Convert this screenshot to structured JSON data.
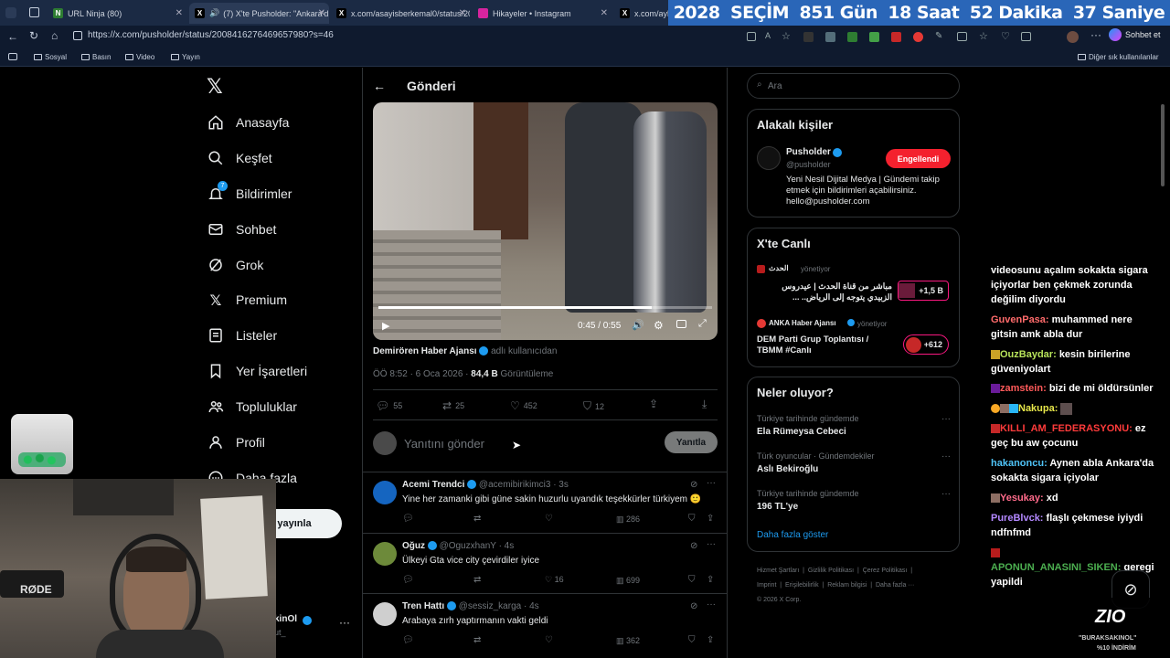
{
  "browser": {
    "tabs": [
      {
        "label": "URL Ninja (80)",
        "active": false
      },
      {
        "label": "(7) X'te Pusholder: \"Ankara'd",
        "active": true
      },
      {
        "label": "x.com/asayisberkemal0/status/20",
        "active": false
      },
      {
        "label": "Hikayeler • Instagram",
        "active": false
      },
      {
        "label": "x.com/ayk",
        "active": false
      }
    ],
    "url": "https://x.com/pusholder/status/2008416276469657980?s=46",
    "chat_button": "Sohbet et",
    "bookmarks": [
      "Sosyal",
      "Basın",
      "Video",
      "Yayın"
    ],
    "other_bookmarks": "Diğer sık kullanılanlar"
  },
  "banner": {
    "items": [
      "2028",
      "SEÇİM",
      "851 Gün",
      "18 Saat",
      "52 Dakika",
      "37 Saniye"
    ]
  },
  "sidebar": {
    "items": [
      {
        "label": "Anasayfa",
        "icon": "home-icon"
      },
      {
        "label": "Keşfet",
        "icon": "search-icon"
      },
      {
        "label": "Bildirimler",
        "icon": "bell-icon"
      },
      {
        "label": "Sohbet",
        "icon": "mail-icon"
      },
      {
        "label": "Grok",
        "icon": "grok-icon"
      },
      {
        "label": "Premium",
        "icon": "x-logo-icon"
      },
      {
        "label": "Listeler",
        "icon": "list-icon"
      },
      {
        "label": "Yer İşaretleri",
        "icon": "bookmark-icon"
      },
      {
        "label": "Topluluklar",
        "icon": "people-icon"
      },
      {
        "label": "Profil",
        "icon": "user-icon"
      },
      {
        "label": "Daha fazla",
        "icon": "more-icon"
      }
    ],
    "notification_badge": "7",
    "post_button": "yayınla",
    "account_name": "kinOl",
    "account_handle": "ut_"
  },
  "main": {
    "header_title": "Gönderi",
    "video_time": "0:45 / 0:55",
    "video_progress": 0.82,
    "attribution_name": "Demirören Haber Ajansı",
    "attribution_suffix": "adlı kullanıcıdan",
    "post_time": "ÖÖ 8:52 · 6 Oca 2026 ·",
    "views": "84,4 B",
    "views_label": "Görüntüleme",
    "stats": {
      "replies": "55",
      "reposts": "25",
      "likes": "452",
      "bookmarks": "12"
    },
    "reply_placeholder": "Yanıtını gönder",
    "reply_button": "Yanıtla",
    "replies": [
      {
        "name": "Acemi Trendci",
        "handle": "@acemibirikimci3 · 3s",
        "text": "Yine her zamanki gibi güne sakin huzurlu uyandık teşekkürler türkiyem 🙂",
        "views": "286",
        "likes": ""
      },
      {
        "name": "Oğuz",
        "handle": "@OguzxhanY · 4s",
        "text": "Ülkeyi Gta vice city çevirdiler iyice",
        "views": "699",
        "likes": "16"
      },
      {
        "name": "Tren Hattı",
        "handle": "@sessiz_karga · 4s",
        "text": "Arabaya zırh yaptırmanın vakti geldi",
        "views": "362",
        "likes": ""
      }
    ]
  },
  "right": {
    "search_placeholder": "Ara",
    "related_title": "Alakalı kişiler",
    "related_name": "Pusholder",
    "related_handle": "@pusholder",
    "related_button": "Engellendi",
    "related_bio": "Yeni Nesil Dijital Medya | Gündemi takip etmek için bildirimleri açabilirsiniz. hello@pusholder.com",
    "live_title": "X'te Canlı",
    "live": [
      {
        "host": "الحدث",
        "role": "yönetiyor",
        "title": "مباشر من قناة الحدث | عيدروس الزبيدي يتوجه إلى الرياض.. ...",
        "count": "+1,5 B"
      },
      {
        "host": "ANKA Haber Ajansı",
        "role": "yönetiyor",
        "title": "DEM Parti Grup Toplantısı / TBMM #Canlı",
        "count": "+612"
      }
    ],
    "trends_title": "Neler oluyor?",
    "trends": [
      {
        "label": "Türkiye tarihinde gündemde",
        "title": "Ela Rümeysa Cebeci"
      },
      {
        "label": "Türk oyuncular · Gündemdekiler",
        "title": "Aslı Bekiroğlu"
      },
      {
        "label": "Türkiye tarihinde gündemde",
        "title": "196 TL'ye"
      }
    ],
    "show_more": "Daha fazla göster",
    "footer_links": [
      "Hizmet Şartları",
      "Gizlilik Politikası",
      "Çerez Politikası",
      "Imprint",
      "Erişilebilirlik",
      "Reklam bilgisi",
      "Daha fazla ···"
    ],
    "copyright": "© 2026 X Corp."
  },
  "chat": [
    {
      "user": "",
      "color": "#ffffff",
      "text": "videosunu açalım sokakta sigara içiyorlar ben çekmek zorunda değilim diyordu"
    },
    {
      "user": "GuvenPasa:",
      "color": "#ff6b6b",
      "text": "muhammed nere gitsin amk abla dur"
    },
    {
      "user": "OuzBaydar:",
      "color": "#b7e35a",
      "text": "kesin birilerine güveniyolart"
    },
    {
      "user": "zamstein:",
      "color": "#ff5a5a",
      "text": "bizi de mi öldürsünler"
    },
    {
      "user": "Nakupa:",
      "color": "#e6e64a",
      "text": ""
    },
    {
      "user": "KILLI_AM_FEDERASYONU:",
      "color": "#ff3b3b",
      "text": "ez geç bu aw çocunu"
    },
    {
      "user": "hakanoncu:",
      "color": "#4fc3f7",
      "text": "Aynen abla Ankara'da sokakta sigara içiyolar"
    },
    {
      "user": "Yesukay:",
      "color": "#ff6b8b",
      "text": "xd"
    },
    {
      "user": "PureBlvck:",
      "color": "#b388ff",
      "text": "flaşlı çekmese iyiydi ndfnfmd"
    },
    {
      "user": "APONUN_ANASINI_SIKEN:",
      "color": "#4caf50",
      "text": "geregi yapildi"
    }
  ],
  "overlay": {
    "mic_label": "RØDE",
    "logo": "ZIO",
    "promo_name": "\"BURAKSAKINOL\"",
    "promo_text": "%10 İNDİRİM"
  }
}
